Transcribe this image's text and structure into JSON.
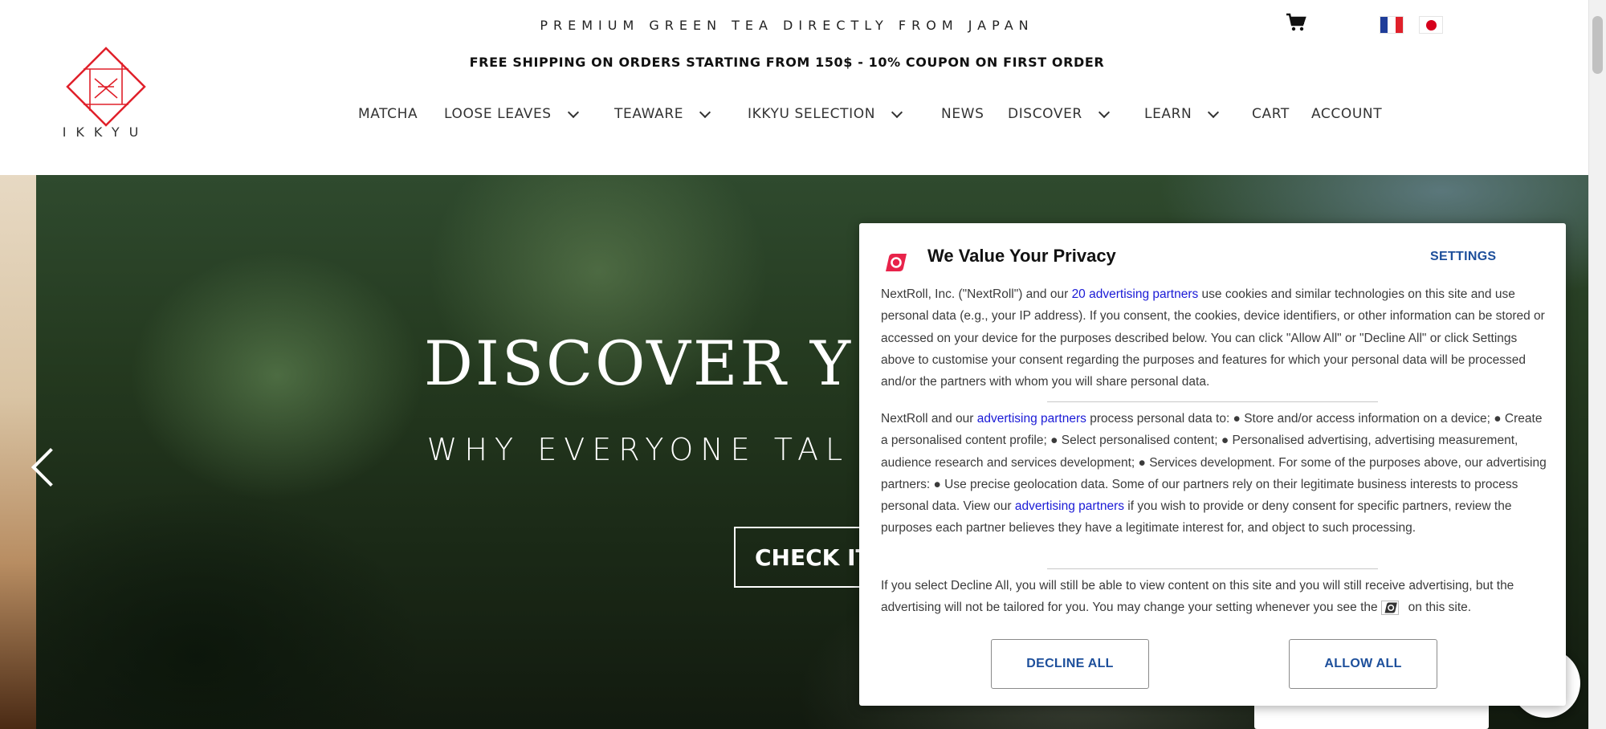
{
  "header": {
    "tagline": "PREMIUM GREEN TEA DIRECTLY FROM JAPAN",
    "shipping_banner": "FREE SHIPPING ON ORDERS STARTING FROM 150$ - 10% COUPON ON FIRST ORDER",
    "logo_text": "IKKYU",
    "nav": [
      "MATCHA",
      "LOOSE LEAVES",
      "TEAWARE",
      "IKKYU SELECTION",
      "NEWS",
      "DISCOVER",
      "LEARN",
      "CART",
      "ACCOUNT"
    ]
  },
  "hero": {
    "title": "DISCOVER Y",
    "subtitle": "WHY EVERYONE TAL",
    "button": "CHECK IT"
  },
  "privacy": {
    "title": "We Value Your Privacy",
    "settings": "SETTINGS",
    "p1_a": "NextRoll, Inc. (\"NextRoll\") and our ",
    "p1_link": "20 advertising partners",
    "p1_b": " use cookies and similar technologies on this site and use personal data (e.g., your IP address). If you consent, the cookies, device identifiers, or other information can be stored or accessed on your device for the purposes described below. You can click \"Allow All\" or \"Decline All\" or click Settings above to customise your consent regarding the purposes and features for which your personal data will be processed and/or the partners with whom you will share personal data.",
    "p2_a": "NextRoll and our ",
    "p2_link1": "advertising partners",
    "p2_b": " process personal data to: ● Store and/or access information on a device; ● Create a personalised content profile; ● Select personalised content; ● Personalised advertising, advertising measurement, audience research and services development; ● Services development. For some of the purposes above, our advertising partners: ● Use precise geolocation data. Some of our partners rely on their legitimate business interests to process personal data. View our ",
    "p2_link2": "advertising partners",
    "p2_c": " if you wish to provide or deny consent for specific partners, review the purposes each partner believes they have a legitimate interest for, and object to such processing.",
    "p3_a": "If you select Decline All, you will still be able to view content on this site and you will still receive advertising, but the advertising will not be tailored for you. You may change your setting whenever you see the",
    "p3_b": "on this site.",
    "decline": "DECLINE ALL",
    "allow": "ALLOW ALL"
  },
  "colors": {
    "brand_red": "#e0202a",
    "link_blue": "#1a1ad6",
    "button_blue": "#1d4f9b",
    "nextroll_pink": "#e8234a"
  }
}
